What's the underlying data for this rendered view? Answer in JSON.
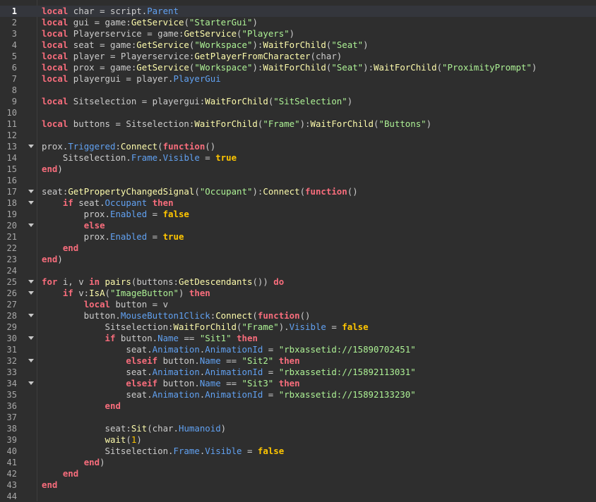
{
  "editor": {
    "current_line": 1,
    "lines": [
      {
        "n": "1",
        "fold": false,
        "tokens": [
          [
            "kw",
            "local"
          ],
          [
            "op",
            " char = script."
          ],
          [
            "prop",
            "Parent"
          ]
        ]
      },
      {
        "n": "2",
        "fold": false,
        "tokens": [
          [
            "kw",
            "local"
          ],
          [
            "op",
            " gui = game:"
          ],
          [
            "fn",
            "GetService"
          ],
          [
            "op",
            "("
          ],
          [
            "str",
            "\"StarterGui\""
          ],
          [
            "op",
            ")"
          ]
        ]
      },
      {
        "n": "3",
        "fold": false,
        "tokens": [
          [
            "kw",
            "local"
          ],
          [
            "op",
            " Playerservice = game:"
          ],
          [
            "fn",
            "GetService"
          ],
          [
            "op",
            "("
          ],
          [
            "str",
            "\"Players\""
          ],
          [
            "op",
            ")"
          ]
        ]
      },
      {
        "n": "4",
        "fold": false,
        "tokens": [
          [
            "kw",
            "local"
          ],
          [
            "op",
            " seat = game:"
          ],
          [
            "fn",
            "GetService"
          ],
          [
            "op",
            "("
          ],
          [
            "str",
            "\"Workspace\""
          ],
          [
            "op",
            "):"
          ],
          [
            "fn",
            "WaitForChild"
          ],
          [
            "op",
            "("
          ],
          [
            "str",
            "\"Seat\""
          ],
          [
            "op",
            ")"
          ]
        ]
      },
      {
        "n": "5",
        "fold": false,
        "tokens": [
          [
            "kw",
            "local"
          ],
          [
            "op",
            " player = Playerservice:"
          ],
          [
            "fn",
            "GetPlayerFromCharacter"
          ],
          [
            "op",
            "(char)"
          ]
        ]
      },
      {
        "n": "6",
        "fold": false,
        "tokens": [
          [
            "kw",
            "local"
          ],
          [
            "op",
            " prox = game:"
          ],
          [
            "fn",
            "GetService"
          ],
          [
            "op",
            "("
          ],
          [
            "str",
            "\"Workspace\""
          ],
          [
            "op",
            "):"
          ],
          [
            "fn",
            "WaitForChild"
          ],
          [
            "op",
            "("
          ],
          [
            "str",
            "\"Seat\""
          ],
          [
            "op",
            "):"
          ],
          [
            "fn",
            "WaitForChild"
          ],
          [
            "op",
            "("
          ],
          [
            "str",
            "\"ProximityPrompt\""
          ],
          [
            "op",
            ")"
          ]
        ]
      },
      {
        "n": "7",
        "fold": false,
        "tokens": [
          [
            "kw",
            "local"
          ],
          [
            "op",
            " playergui = player."
          ],
          [
            "prop",
            "PlayerGui"
          ]
        ]
      },
      {
        "n": "8",
        "fold": false,
        "tokens": []
      },
      {
        "n": "9",
        "fold": false,
        "tokens": [
          [
            "kw",
            "local"
          ],
          [
            "op",
            " Sitselection = playergui:"
          ],
          [
            "fn",
            "WaitForChild"
          ],
          [
            "op",
            "("
          ],
          [
            "str",
            "\"SitSelection\""
          ],
          [
            "op",
            ")"
          ]
        ]
      },
      {
        "n": "10",
        "fold": false,
        "tokens": []
      },
      {
        "n": "11",
        "fold": false,
        "tokens": [
          [
            "kw",
            "local"
          ],
          [
            "op",
            " buttons = Sitselection:"
          ],
          [
            "fn",
            "WaitForChild"
          ],
          [
            "op",
            "("
          ],
          [
            "str",
            "\"Frame\""
          ],
          [
            "op",
            "):"
          ],
          [
            "fn",
            "WaitForChild"
          ],
          [
            "op",
            "("
          ],
          [
            "str",
            "\"Buttons\""
          ],
          [
            "op",
            ")"
          ]
        ]
      },
      {
        "n": "12",
        "fold": false,
        "tokens": []
      },
      {
        "n": "13",
        "fold": true,
        "tokens": [
          [
            "op",
            "prox."
          ],
          [
            "prop",
            "Triggered"
          ],
          [
            "op",
            ":"
          ],
          [
            "fn",
            "Connect"
          ],
          [
            "op",
            "("
          ],
          [
            "kw",
            "function"
          ],
          [
            "op",
            "()"
          ]
        ]
      },
      {
        "n": "14",
        "fold": false,
        "tokens": [
          [
            "op",
            "    Sitselection."
          ],
          [
            "prop",
            "Frame"
          ],
          [
            "op",
            "."
          ],
          [
            "prop",
            "Visible"
          ],
          [
            "op",
            " = "
          ],
          [
            "bool",
            "true"
          ]
        ]
      },
      {
        "n": "15",
        "fold": false,
        "tokens": [
          [
            "kw",
            "end"
          ],
          [
            "op",
            ")"
          ]
        ]
      },
      {
        "n": "16",
        "fold": false,
        "tokens": []
      },
      {
        "n": "17",
        "fold": true,
        "tokens": [
          [
            "op",
            "seat:"
          ],
          [
            "fn",
            "GetPropertyChangedSignal"
          ],
          [
            "op",
            "("
          ],
          [
            "str",
            "\"Occupant\""
          ],
          [
            "op",
            "):"
          ],
          [
            "fn",
            "Connect"
          ],
          [
            "op",
            "("
          ],
          [
            "kw",
            "function"
          ],
          [
            "op",
            "()"
          ]
        ]
      },
      {
        "n": "18",
        "fold": true,
        "tokens": [
          [
            "op",
            "    "
          ],
          [
            "kw",
            "if"
          ],
          [
            "op",
            " seat."
          ],
          [
            "prop",
            "Occupant"
          ],
          [
            "op",
            " "
          ],
          [
            "kw",
            "then"
          ]
        ]
      },
      {
        "n": "19",
        "fold": false,
        "tokens": [
          [
            "op",
            "        prox."
          ],
          [
            "prop",
            "Enabled"
          ],
          [
            "op",
            " = "
          ],
          [
            "bool",
            "false"
          ]
        ]
      },
      {
        "n": "20",
        "fold": true,
        "tokens": [
          [
            "op",
            "        "
          ],
          [
            "kw",
            "else"
          ]
        ]
      },
      {
        "n": "21",
        "fold": false,
        "tokens": [
          [
            "op",
            "        prox."
          ],
          [
            "prop",
            "Enabled"
          ],
          [
            "op",
            " = "
          ],
          [
            "bool",
            "true"
          ]
        ]
      },
      {
        "n": "22",
        "fold": false,
        "tokens": [
          [
            "op",
            "    "
          ],
          [
            "kw",
            "end"
          ]
        ]
      },
      {
        "n": "23",
        "fold": false,
        "tokens": [
          [
            "kw",
            "end"
          ],
          [
            "op",
            ")"
          ]
        ]
      },
      {
        "n": "24",
        "fold": false,
        "tokens": []
      },
      {
        "n": "25",
        "fold": true,
        "tokens": [
          [
            "kw",
            "for"
          ],
          [
            "op",
            " i, v "
          ],
          [
            "kw",
            "in"
          ],
          [
            "op",
            " "
          ],
          [
            "fn",
            "pairs"
          ],
          [
            "op",
            "(buttons:"
          ],
          [
            "fn",
            "GetDescendants"
          ],
          [
            "op",
            "()) "
          ],
          [
            "kw",
            "do"
          ]
        ]
      },
      {
        "n": "26",
        "fold": true,
        "tokens": [
          [
            "op",
            "    "
          ],
          [
            "kw",
            "if"
          ],
          [
            "op",
            " v:"
          ],
          [
            "fn",
            "IsA"
          ],
          [
            "op",
            "("
          ],
          [
            "str",
            "\"ImageButton\""
          ],
          [
            "op",
            ") "
          ],
          [
            "kw",
            "then"
          ]
        ]
      },
      {
        "n": "27",
        "fold": false,
        "tokens": [
          [
            "op",
            "        "
          ],
          [
            "kw",
            "local"
          ],
          [
            "op",
            " button = v"
          ]
        ]
      },
      {
        "n": "28",
        "fold": true,
        "tokens": [
          [
            "op",
            "        button."
          ],
          [
            "prop",
            "MouseButton1Click"
          ],
          [
            "op",
            ":"
          ],
          [
            "fn",
            "Connect"
          ],
          [
            "op",
            "("
          ],
          [
            "kw",
            "function"
          ],
          [
            "op",
            "()"
          ]
        ]
      },
      {
        "n": "29",
        "fold": false,
        "tokens": [
          [
            "op",
            "            Sitselection:"
          ],
          [
            "fn",
            "WaitForChild"
          ],
          [
            "op",
            "("
          ],
          [
            "str",
            "\"Frame\""
          ],
          [
            "op",
            ")."
          ],
          [
            "prop",
            "Visible"
          ],
          [
            "op",
            " = "
          ],
          [
            "bool",
            "false"
          ]
        ]
      },
      {
        "n": "30",
        "fold": true,
        "tokens": [
          [
            "op",
            "            "
          ],
          [
            "kw",
            "if"
          ],
          [
            "op",
            " button."
          ],
          [
            "prop",
            "Name"
          ],
          [
            "op",
            " == "
          ],
          [
            "str",
            "\"Sit1\""
          ],
          [
            "op",
            " "
          ],
          [
            "kw",
            "then"
          ]
        ]
      },
      {
        "n": "31",
        "fold": false,
        "tokens": [
          [
            "op",
            "                seat."
          ],
          [
            "prop",
            "Animation"
          ],
          [
            "op",
            "."
          ],
          [
            "prop",
            "AnimationId"
          ],
          [
            "op",
            " = "
          ],
          [
            "str",
            "\"rbxassetid://15890702451\""
          ]
        ]
      },
      {
        "n": "32",
        "fold": true,
        "tokens": [
          [
            "op",
            "                "
          ],
          [
            "kw",
            "elseif"
          ],
          [
            "op",
            " button."
          ],
          [
            "prop",
            "Name"
          ],
          [
            "op",
            " == "
          ],
          [
            "str",
            "\"Sit2\""
          ],
          [
            "op",
            " "
          ],
          [
            "kw",
            "then"
          ]
        ]
      },
      {
        "n": "33",
        "fold": false,
        "tokens": [
          [
            "op",
            "                seat."
          ],
          [
            "prop",
            "Animation"
          ],
          [
            "op",
            "."
          ],
          [
            "prop",
            "AnimationId"
          ],
          [
            "op",
            " = "
          ],
          [
            "str",
            "\"rbxassetid://15892113031\""
          ]
        ]
      },
      {
        "n": "34",
        "fold": true,
        "tokens": [
          [
            "op",
            "                "
          ],
          [
            "kw",
            "elseif"
          ],
          [
            "op",
            " button."
          ],
          [
            "prop",
            "Name"
          ],
          [
            "op",
            " == "
          ],
          [
            "str",
            "\"Sit3\""
          ],
          [
            "op",
            " "
          ],
          [
            "kw",
            "then"
          ]
        ]
      },
      {
        "n": "35",
        "fold": false,
        "tokens": [
          [
            "op",
            "                seat."
          ],
          [
            "prop",
            "Animation"
          ],
          [
            "op",
            "."
          ],
          [
            "prop",
            "AnimationId"
          ],
          [
            "op",
            " = "
          ],
          [
            "str",
            "\"rbxassetid://15892133230\""
          ]
        ]
      },
      {
        "n": "36",
        "fold": false,
        "tokens": [
          [
            "op",
            "            "
          ],
          [
            "kw",
            "end"
          ]
        ]
      },
      {
        "n": "37",
        "fold": false,
        "tokens": []
      },
      {
        "n": "38",
        "fold": false,
        "tokens": [
          [
            "op",
            "            seat:"
          ],
          [
            "fn",
            "Sit"
          ],
          [
            "op",
            "(char."
          ],
          [
            "prop",
            "Humanoid"
          ],
          [
            "op",
            ")"
          ]
        ]
      },
      {
        "n": "39",
        "fold": false,
        "tokens": [
          [
            "op",
            "            "
          ],
          [
            "fn",
            "wait"
          ],
          [
            "op",
            "("
          ],
          [
            "num",
            "1"
          ],
          [
            "op",
            ")"
          ]
        ]
      },
      {
        "n": "40",
        "fold": false,
        "tokens": [
          [
            "op",
            "            Sitselection."
          ],
          [
            "prop",
            "Frame"
          ],
          [
            "op",
            "."
          ],
          [
            "prop",
            "Visible"
          ],
          [
            "op",
            " = "
          ],
          [
            "bool",
            "false"
          ]
        ]
      },
      {
        "n": "41",
        "fold": false,
        "tokens": [
          [
            "op",
            "        "
          ],
          [
            "kw",
            "end"
          ],
          [
            "op",
            ")"
          ]
        ]
      },
      {
        "n": "42",
        "fold": false,
        "tokens": [
          [
            "op",
            "    "
          ],
          [
            "kw",
            "end"
          ]
        ]
      },
      {
        "n": "43",
        "fold": false,
        "tokens": [
          [
            "kw",
            "end"
          ]
        ]
      },
      {
        "n": "44",
        "fold": false,
        "tokens": []
      }
    ]
  }
}
